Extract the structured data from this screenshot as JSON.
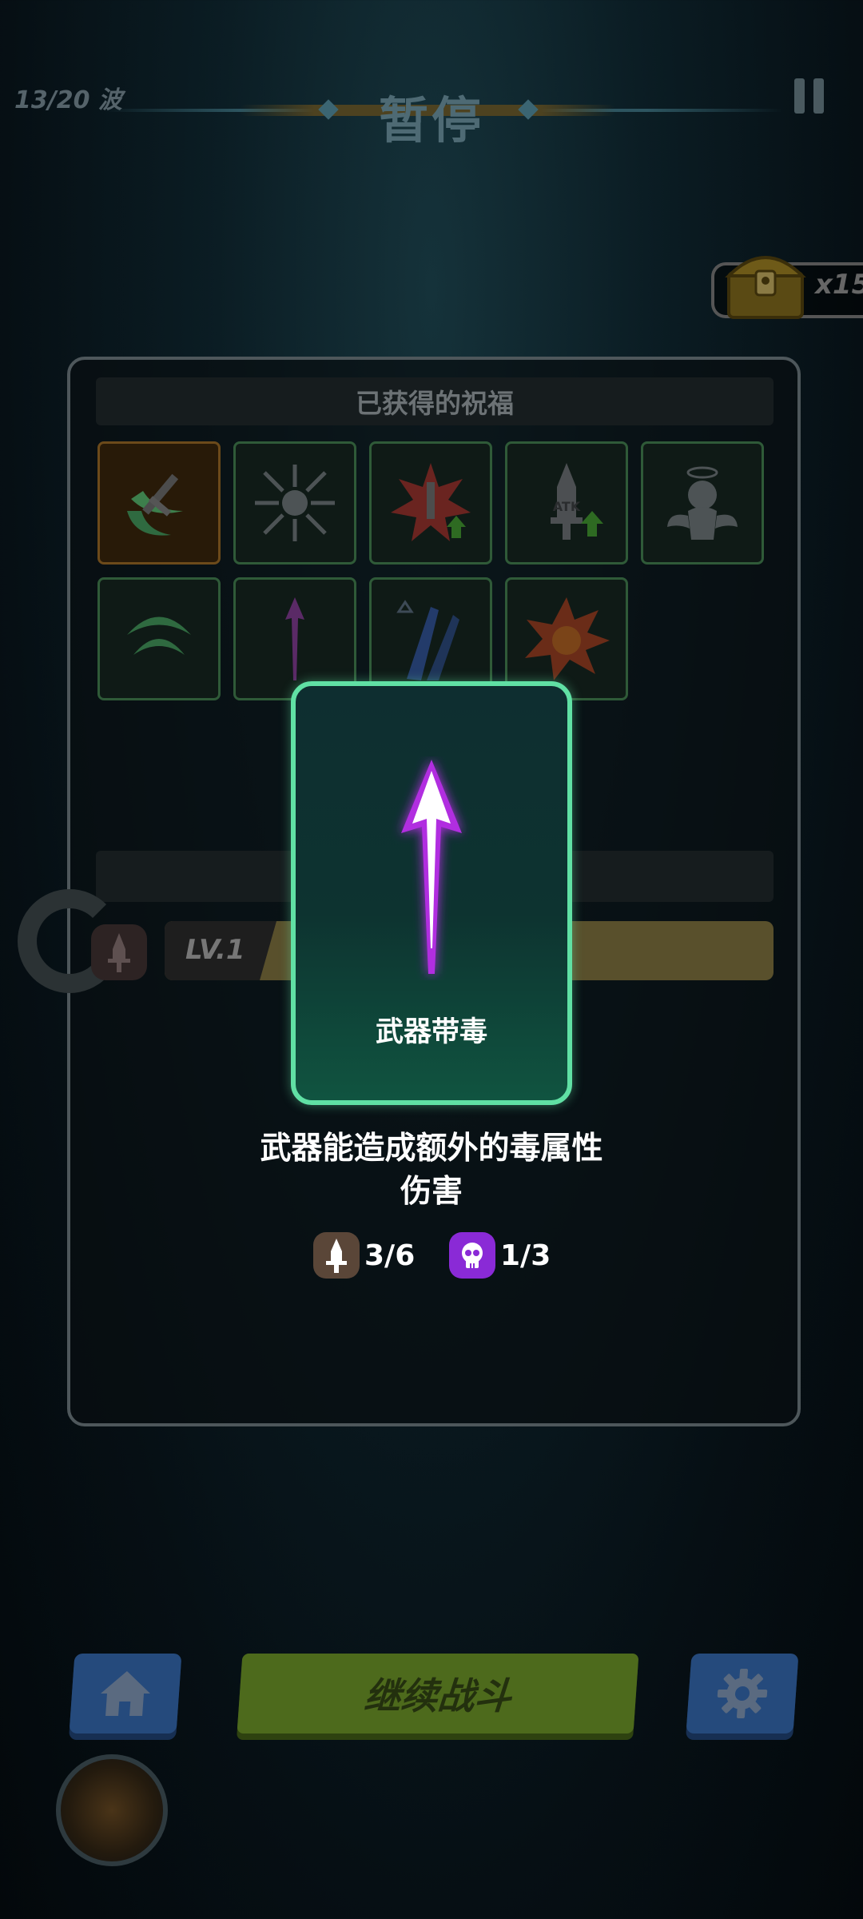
{
  "hud": {
    "wave": "13/20 波",
    "title": "暂停",
    "chest_count": "x15"
  },
  "panel": {
    "header": "已获得的祝福",
    "blessings": [
      {
        "icon": "green-sword-slash-icon",
        "highlighted": true
      },
      {
        "icon": "skull-arrows-icon"
      },
      {
        "icon": "burst-sword-up-icon"
      },
      {
        "icon": "atk-up-icon"
      },
      {
        "icon": "angel-icon"
      },
      {
        "icon": "green-crescent-icon"
      },
      {
        "icon": "poison-arrow-icon"
      },
      {
        "icon": "ice-shards-icon"
      },
      {
        "icon": "explosion-skull-icon"
      }
    ],
    "weapon_level": "LV.1"
  },
  "card": {
    "name": "武器带毒",
    "rarity_color": "#60e0a4",
    "description_line1": "武器能造成额外的毒属性",
    "description_line2": "伤害"
  },
  "stats": {
    "weapon": "3/6",
    "poison": "1/3"
  },
  "buttons": {
    "continue": "继续战斗"
  }
}
